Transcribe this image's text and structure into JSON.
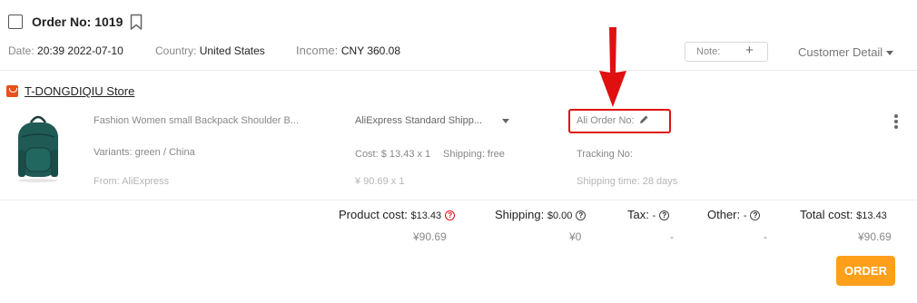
{
  "header": {
    "order_no": "Order No: 1019",
    "date_label": "Date:",
    "date_value": "20:39 2022-07-10",
    "country_label": "Country:",
    "country_value": "United States",
    "income_label": "Income:",
    "income_value": "CNY 360.08",
    "note_label": "Note:",
    "note_plus": "+",
    "customer_detail": "Customer Detail"
  },
  "store": {
    "name": "T-DONGDIQIU Store"
  },
  "product": {
    "title": "Fashion Women small Backpack Shoulder B...",
    "variants": "Variants: green / China",
    "from": "From: AliExpress",
    "shipping_method": "AliExpress Standard Shipp...",
    "cost": "Cost: $ 13.43 x 1",
    "shipping": "Shipping: free",
    "cny_cost": "¥ 90.69 x 1",
    "ali_order_no": "Ali Order No:",
    "tracking_no": "Tracking No:",
    "shipping_time": "Shipping time: 28 days"
  },
  "totals": {
    "product_cost_label": "Product cost:",
    "product_cost_value": "$13.43",
    "product_cost_cny": "¥90.69",
    "shipping_label": "Shipping:",
    "shipping_value": "$0.00",
    "shipping_cny": "¥0",
    "tax_label": "Tax:",
    "tax_value": "-",
    "tax_cny": "-",
    "other_label": "Other:",
    "other_value": "-",
    "other_cny": "-",
    "total_label": "Total cost:",
    "total_value": "$13.43",
    "total_cny": "¥90.69"
  },
  "actions": {
    "order_button": "ORDER"
  },
  "colors": {
    "accent_orange": "#ff9f1a",
    "annotation_red": "#e01010",
    "store_icon": "#e8501c"
  }
}
